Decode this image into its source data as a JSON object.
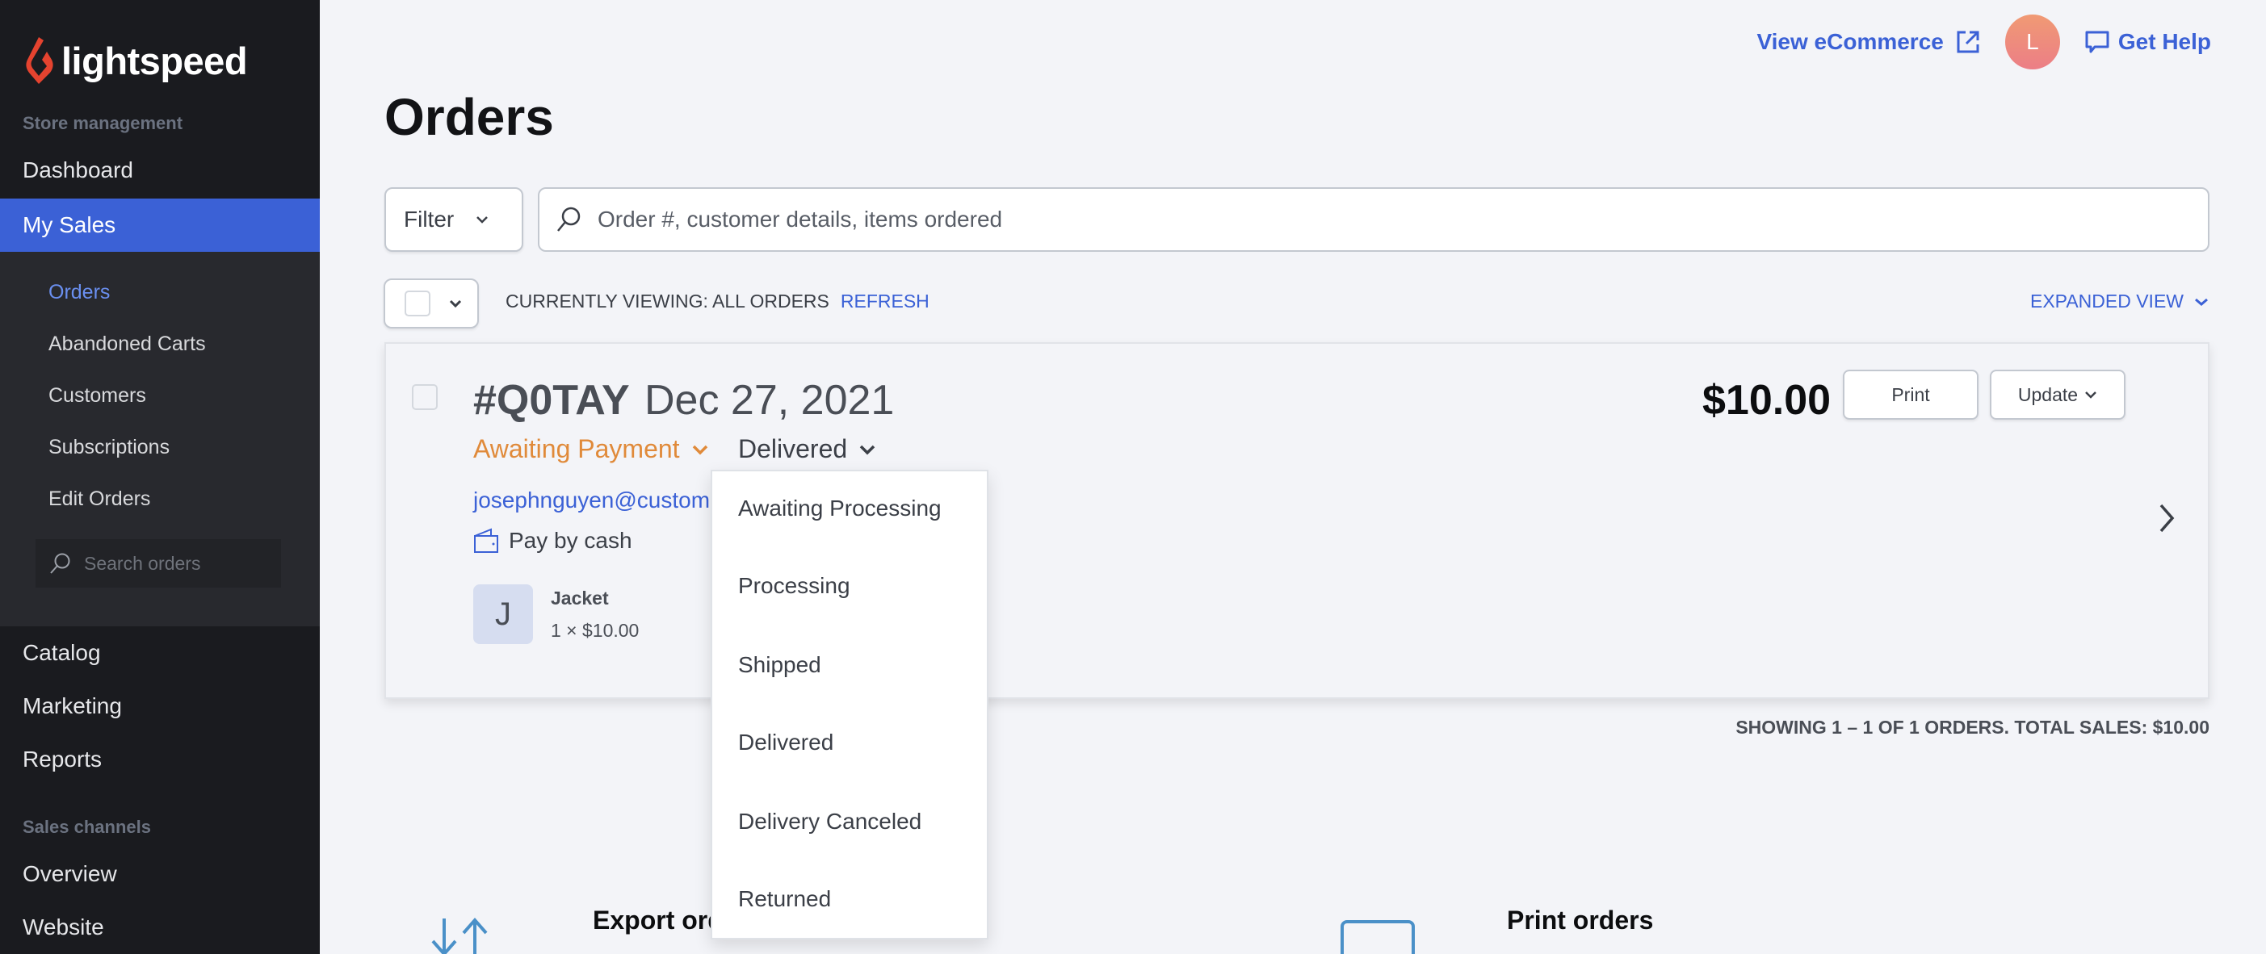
{
  "app": {
    "brand": "lightspeed",
    "colors": {
      "accent": "#3b61d6",
      "sidebar_bg": "#1a1b1f",
      "payment_status": "#e08a3a",
      "logo_red": "#e5432f"
    }
  },
  "sidebar": {
    "section_store": "Store management",
    "items_top": [
      {
        "label": "Dashboard",
        "active": false
      },
      {
        "label": "My Sales",
        "active": true
      }
    ],
    "subitems": [
      {
        "label": "Orders",
        "active": true
      },
      {
        "label": "Abandoned Carts",
        "active": false
      },
      {
        "label": "Customers",
        "active": false
      },
      {
        "label": "Subscriptions",
        "active": false
      },
      {
        "label": "Edit Orders",
        "active": false
      }
    ],
    "search_placeholder": "Search orders",
    "items_bottom": [
      {
        "label": "Catalog"
      },
      {
        "label": "Marketing"
      },
      {
        "label": "Reports"
      }
    ],
    "section_channels": "Sales channels",
    "channel_items": [
      {
        "label": "Overview"
      },
      {
        "label": "Website"
      }
    ]
  },
  "topbar": {
    "view_ecommerce": "View eCommerce",
    "avatar_initial": "L",
    "get_help": "Get Help"
  },
  "page": {
    "title": "Orders",
    "filter_label": "Filter",
    "search_placeholder": "Order #, customer details, items ordered",
    "viewing_label": "CURRENTLY VIEWING: ALL ORDERS",
    "refresh_label": "REFRESH",
    "view_mode": "EXPANDED VIEW"
  },
  "order": {
    "id": "#Q0TAY",
    "date": "Dec 27, 2021",
    "payment_status": "Awaiting Payment",
    "fulfillment_status": "Delivered",
    "email": "josephnguyen@custome",
    "payment_method": "Pay by cash",
    "item": {
      "initial": "J",
      "name": "Jacket",
      "qty_price": "1 × $10.00"
    },
    "total": "$10.00",
    "print_label": "Print",
    "update_label": "Update"
  },
  "status_dropdown": {
    "options": [
      "Awaiting Processing",
      "Processing",
      "Shipped",
      "Delivered",
      "Delivery Canceled",
      "Returned"
    ]
  },
  "summary": "SHOWING 1 – 1 OF 1 ORDERS. TOTAL SALES: $10.00",
  "bottom": {
    "export_title": "Export orders",
    "print_title": "Print orders"
  }
}
